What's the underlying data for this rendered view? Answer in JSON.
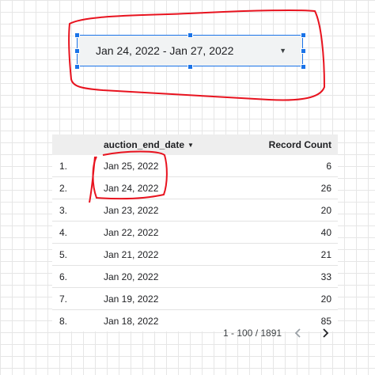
{
  "date_control": {
    "value": "Jan 24, 2022 - Jan 27, 2022",
    "arrow": "▼"
  },
  "table": {
    "columns": [
      "auction_end_date",
      "Record Count"
    ],
    "sort_indicator": "▼",
    "rows": [
      {
        "index": "1.",
        "date": "Jan 25, 2022",
        "count": "6"
      },
      {
        "index": "2.",
        "date": "Jan 24, 2022",
        "count": "26"
      },
      {
        "index": "3.",
        "date": "Jan 23, 2022",
        "count": "20"
      },
      {
        "index": "4.",
        "date": "Jan 22, 2022",
        "count": "40"
      },
      {
        "index": "5.",
        "date": "Jan 21, 2022",
        "count": "21"
      },
      {
        "index": "6.",
        "date": "Jan 20, 2022",
        "count": "33"
      },
      {
        "index": "7.",
        "date": "Jan 19, 2022",
        "count": "20"
      },
      {
        "index": "8.",
        "date": "Jan 18, 2022",
        "count": "85"
      }
    ]
  },
  "pagination": {
    "label": "1 - 100 / 1891",
    "prev_icon": "chevron-left-icon",
    "next_icon": "chevron-right-icon"
  },
  "colors": {
    "selection": "#1a73e8",
    "annotation": "#e8131f",
    "header_bg": "#eeeeee"
  }
}
